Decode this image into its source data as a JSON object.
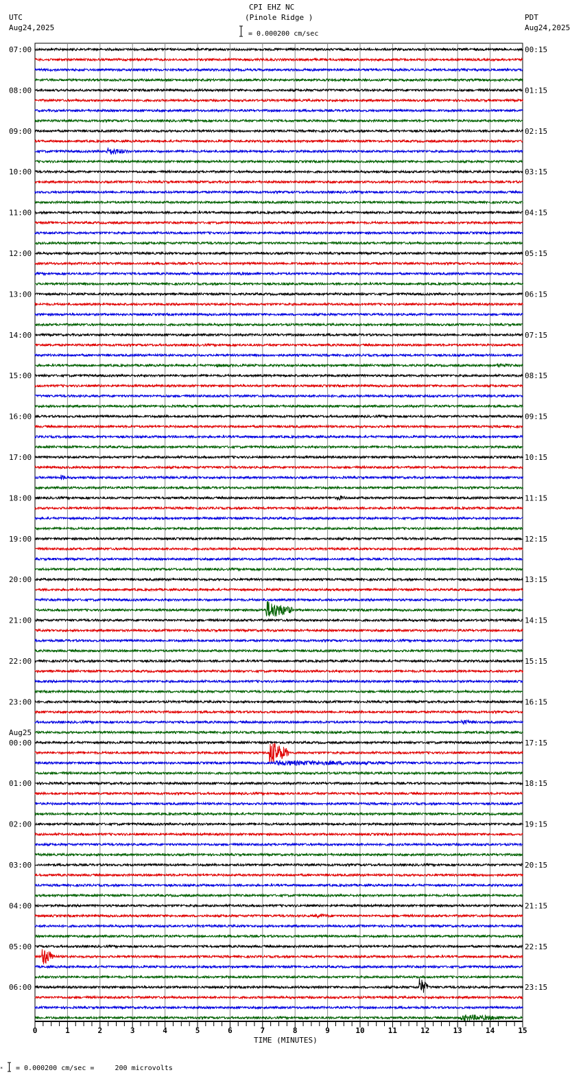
{
  "header": {
    "title": "CPI EHZ NC",
    "subtitle": "(Pinole Ridge )",
    "left_zone": "UTC",
    "left_date": "Aug24,2025",
    "right_zone": "PDT",
    "right_date": "Aug24,2025",
    "scale_text": "= 0.000200 cm/sec"
  },
  "footer": {
    "scale_text": "= 0.000200 cm/sec =     200 microvolts"
  },
  "chart_data": {
    "type": "line",
    "title": "CPI EHZ NC (Pinole Ridge )",
    "xlabel": "TIME (MINUTES)",
    "xlim": [
      0,
      15
    ],
    "x_ticks": [
      "0",
      "1",
      "2",
      "3",
      "4",
      "5",
      "6",
      "7",
      "8",
      "9",
      "10",
      "11",
      "12",
      "13",
      "14",
      "15"
    ],
    "traces_per_hour": 4,
    "trace_colors": [
      "#000000",
      "#e00000",
      "#0000e0",
      "#006000"
    ],
    "date_change_label": "Aug25",
    "utc_labels": [
      "07:00",
      "08:00",
      "09:00",
      "10:00",
      "11:00",
      "12:00",
      "13:00",
      "14:00",
      "15:00",
      "16:00",
      "17:00",
      "18:00",
      "19:00",
      "20:00",
      "21:00",
      "22:00",
      "23:00",
      "00:00",
      "01:00",
      "02:00",
      "03:00",
      "04:00",
      "05:00",
      "06:00"
    ],
    "pdt_labels": [
      "00:15",
      "01:15",
      "02:15",
      "03:15",
      "04:15",
      "05:15",
      "06:15",
      "07:15",
      "08:15",
      "09:15",
      "10:15",
      "11:15",
      "12:15",
      "13:15",
      "14:15",
      "15:15",
      "16:15",
      "17:15",
      "18:15",
      "19:15",
      "20:15",
      "21:15",
      "22:15",
      "23:15"
    ],
    "events": [
      {
        "trace": 2,
        "start": 8.0,
        "end": 11.5,
        "amp": 2.0
      },
      {
        "trace": 10,
        "start": 2.2,
        "end": 2.9,
        "amp": 6
      },
      {
        "trace": 22,
        "start": 6.2,
        "end": 8.2,
        "amp": 2.2
      },
      {
        "trace": 31,
        "start": 5.5,
        "end": 7.2,
        "amp": 2.5
      },
      {
        "trace": 31,
        "start": 14.2,
        "end": 15,
        "amp": 3
      },
      {
        "trace": 42,
        "start": 0.8,
        "end": 1.1,
        "amp": 4
      },
      {
        "trace": 44,
        "start": 9.3,
        "end": 9.7,
        "amp": 4
      },
      {
        "trace": 55,
        "start": 7.1,
        "end": 7.9,
        "amp": 14
      },
      {
        "trace": 66,
        "start": 13.1,
        "end": 13.7,
        "amp": 4
      },
      {
        "trace": 69,
        "start": 7.2,
        "end": 7.8,
        "amp": 18
      },
      {
        "trace": 70,
        "start": 7.4,
        "end": 12.5,
        "amp": 4
      },
      {
        "trace": 85,
        "start": 8.6,
        "end": 9.6,
        "amp": 3
      },
      {
        "trace": 89,
        "start": 0.2,
        "end": 0.6,
        "amp": 14
      },
      {
        "trace": 92,
        "start": 11.8,
        "end": 12.1,
        "amp": 14
      },
      {
        "trace": 95,
        "start": 13.1,
        "end": 15,
        "amp": 5
      }
    ]
  }
}
